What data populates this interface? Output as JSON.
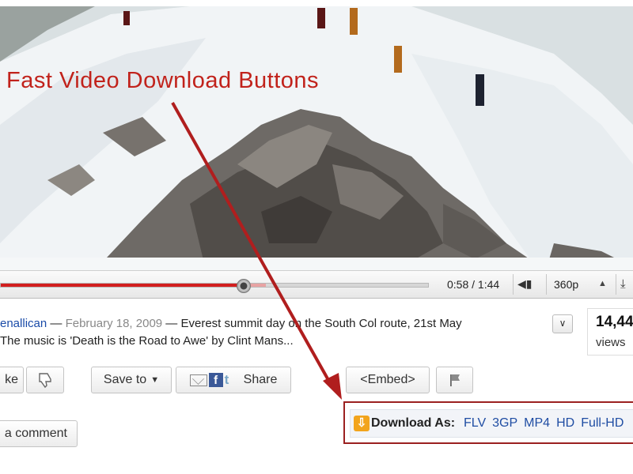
{
  "annotation": {
    "title": "Fast Video Download Buttons"
  },
  "player": {
    "time": "0:58 / 1:44",
    "quality": "360p",
    "progress": 0.568,
    "buffered": 0.62
  },
  "description": {
    "username": "enallican",
    "separator1": " — ",
    "date": "February 18, 2009",
    "separator2": " — ",
    "text_line1": "Everest summit day on the South Col route, 21st May",
    "text_line2": "The music is 'Death is the Road to Awe' by Clint Mans..."
  },
  "views": {
    "count": "14,44",
    "label": "views"
  },
  "buttons": {
    "like": "ke",
    "save_to": "Save to",
    "share": "Share",
    "embed": "<Embed>",
    "comment": "a comment"
  },
  "download": {
    "label": "Download As:",
    "formats": [
      "FLV",
      "3GP",
      "MP4",
      "HD",
      "Full-HD"
    ]
  },
  "colors": {
    "annotation": "#c1221b",
    "progress": "#d21f1f",
    "link": "#1f4da3"
  }
}
